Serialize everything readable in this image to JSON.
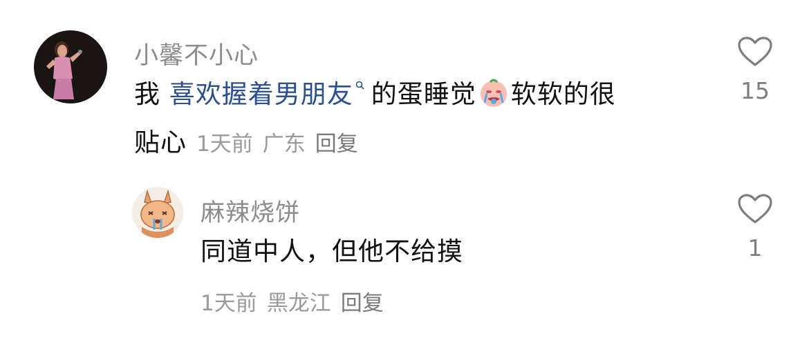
{
  "comments": [
    {
      "username": "小馨不小心",
      "text_parts": {
        "prefix": "我 ",
        "link": "喜欢握着男朋友",
        "middle": "的蛋睡觉",
        "suffix_line1": "软软的很",
        "suffix_line2": "贴心"
      },
      "emoji": "crying-face-emoji",
      "time": "1天前",
      "location": "广东",
      "reply_label": "回复",
      "likes": "15"
    },
    {
      "username": "麻辣烧饼",
      "text": "同道中人，但他不给摸",
      "time": "1天前",
      "location": "黑龙江",
      "reply_label": "回复",
      "likes": "1"
    }
  ],
  "icons": {
    "like": "heart-outline-icon",
    "search": "search-mark-icon"
  },
  "colors": {
    "username": "#8c8c8c",
    "text": "#111111",
    "link": "#2b4f8f",
    "meta": "#9a9a9a"
  }
}
